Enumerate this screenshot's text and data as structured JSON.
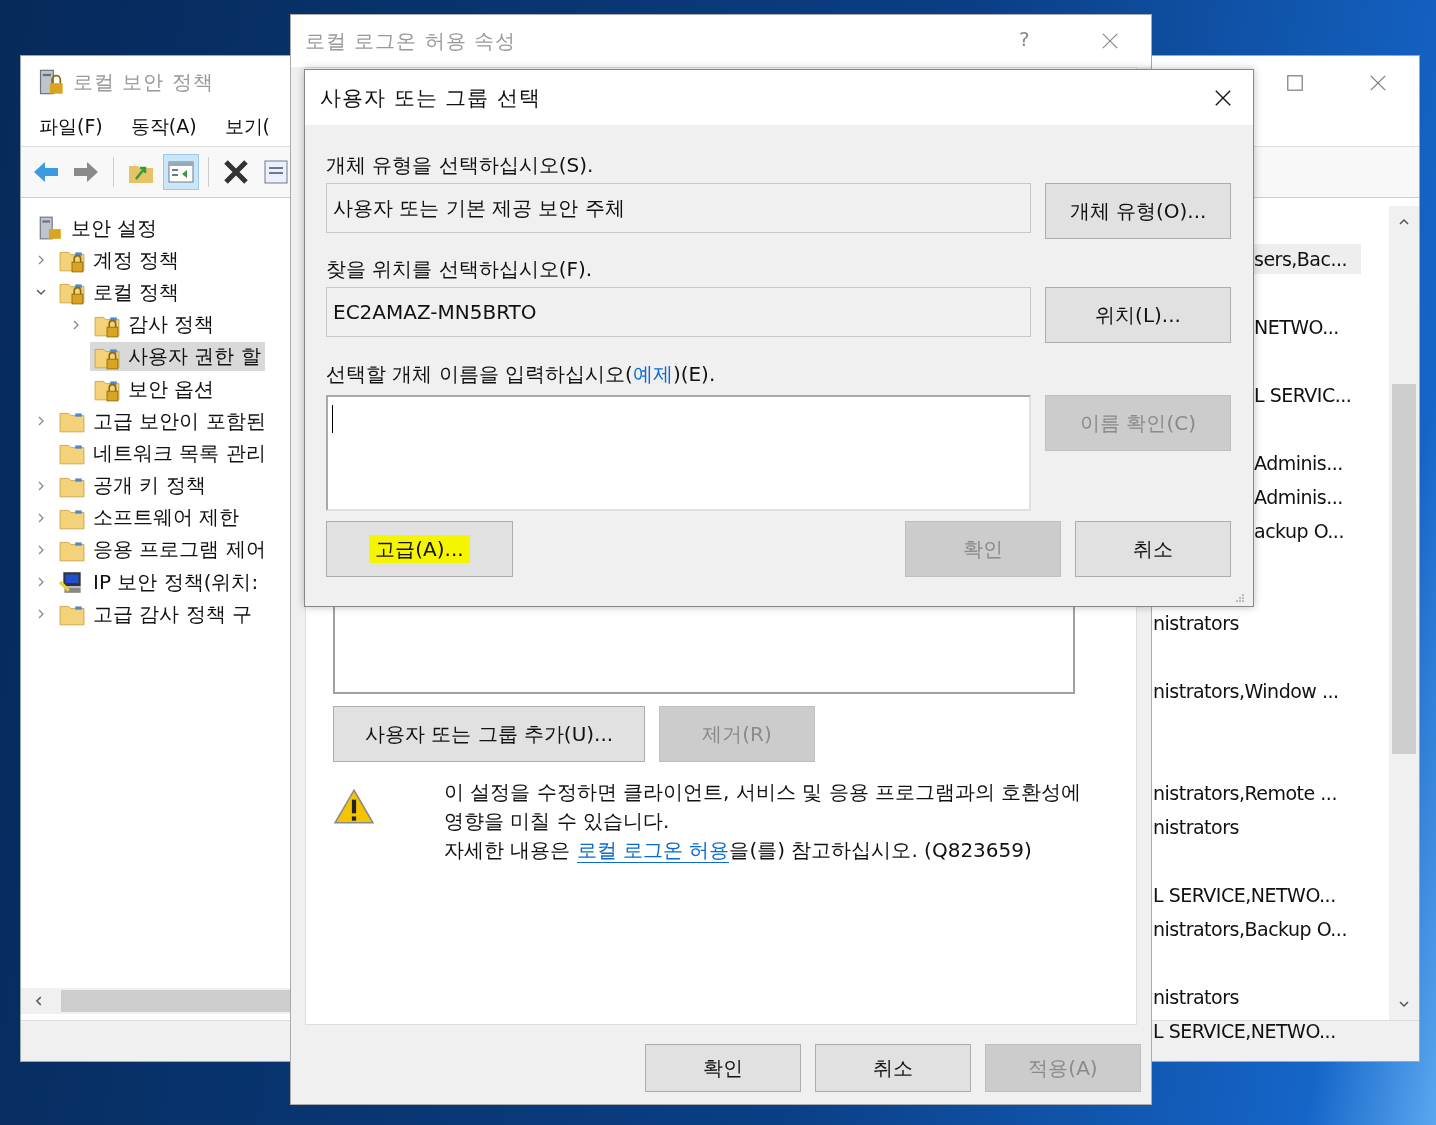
{
  "main_window": {
    "title": "로컬 보안 정책",
    "menu": [
      {
        "label": "파일(F)"
      },
      {
        "label": "동작(A)"
      },
      {
        "label": "보기("
      }
    ],
    "toolbar": [
      {
        "kind": "back",
        "selected": false
      },
      {
        "kind": "forward",
        "selected": false
      },
      {
        "kind": "up",
        "selected": false
      },
      {
        "kind": "pane",
        "selected": true
      },
      {
        "kind": "delete",
        "selected": false
      },
      {
        "kind": "properties",
        "selected": false
      }
    ],
    "tree": [
      {
        "label": "보안 설정",
        "kind": "server",
        "selected": false,
        "children": [
          {
            "label": "계정 정책",
            "kind": "lock-folder",
            "expandable": true,
            "expanded": false,
            "selected": false
          },
          {
            "label": "로컬 정책",
            "kind": "lock-folder",
            "expandable": true,
            "expanded": true,
            "selected": false,
            "children": [
              {
                "label": "감사 정책",
                "kind": "lock-folder",
                "expandable": true,
                "expanded": false,
                "selected": false
              },
              {
                "label": "사용자 권한 할",
                "kind": "lock-folder",
                "expandable": false,
                "selected": true
              },
              {
                "label": "보안 옵션",
                "kind": "lock-folder",
                "expandable": false,
                "selected": false
              }
            ]
          },
          {
            "label": "고급 보안이 포함된",
            "kind": "folder",
            "expandable": true,
            "expanded": false,
            "selected": false
          },
          {
            "label": "네트워크 목록 관리",
            "kind": "folder",
            "expandable": false,
            "selected": false
          },
          {
            "label": "공개 키 정책",
            "kind": "folder",
            "expandable": true,
            "expanded": false,
            "selected": false
          },
          {
            "label": "소프트웨어 제한",
            "kind": "folder",
            "expandable": true,
            "expanded": false,
            "selected": false
          },
          {
            "label": "응용 프로그램 제어",
            "kind": "folder",
            "expandable": true,
            "expanded": false,
            "selected": false
          },
          {
            "label": "IP 보안 정책(위치:",
            "kind": "ip",
            "expandable": true,
            "expanded": false,
            "selected": false
          },
          {
            "label": "고급 감사 정책 구",
            "kind": "folder",
            "expandable": true,
            "expanded": false,
            "selected": false
          }
        ]
      }
    ],
    "right_pane": {
      "rows_beside_picker": [
        {
          "kind": "gap"
        },
        {
          "kind": "text",
          "text": "sers,Bac...",
          "selected": true
        },
        {
          "kind": "gap"
        },
        {
          "kind": "text",
          "text": "NETWO...",
          "selected": false
        },
        {
          "kind": "gap"
        },
        {
          "kind": "text",
          "text": "L SERVIC...",
          "selected": false
        },
        {
          "kind": "gap"
        },
        {
          "kind": "text",
          "text": "Adminis...",
          "selected": false
        },
        {
          "kind": "text",
          "text": "Adminis...",
          "selected": false
        },
        {
          "kind": "text",
          "text": "ackup O...",
          "selected": false
        }
      ],
      "rows_below_picker": [
        {
          "kind": "text",
          "text": "nistrators",
          "selected": false
        },
        {
          "kind": "gap"
        },
        {
          "kind": "text",
          "text": "nistrators,Window ...",
          "selected": false
        },
        {
          "kind": "gap"
        },
        {
          "kind": "gap"
        },
        {
          "kind": "text",
          "text": "nistrators,Remote ...",
          "selected": false
        },
        {
          "kind": "text",
          "text": "nistrators",
          "selected": false
        },
        {
          "kind": "gap"
        },
        {
          "kind": "text",
          "text": "L SERVICE,NETWO...",
          "selected": false
        },
        {
          "kind": "text",
          "text": "nistrators,Backup O...",
          "selected": false
        },
        {
          "kind": "gap"
        },
        {
          "kind": "text",
          "text": "nistrators",
          "selected": false
        },
        {
          "kind": "text",
          "text": "L SERVICE,NETWO...",
          "selected": false
        }
      ]
    }
  },
  "properties_dialog": {
    "title": "로컬 로그온 허용 속성",
    "help": "?",
    "add_button": {
      "label": "사용자 또는 그룹 추가(U)...",
      "disabled": false
    },
    "remove_button": {
      "label": "제거(R)",
      "disabled": true
    },
    "warning": {
      "text": "이 설정을 수정하면 클라이언트, 서비스 및 응용 프로그램과의 호환성에 영향을 미칠 수 있습니다.",
      "more_before": "자세한 내용은 ",
      "more_link": "로컬 로그온 허용",
      "more_after": "을(를) 참고하십시오. (Q823659)"
    },
    "buttons": [
      {
        "label": "확인",
        "disabled": false
      },
      {
        "label": "취소",
        "disabled": false
      },
      {
        "label": "적용(A)",
        "disabled": true
      }
    ]
  },
  "picker": {
    "title": "사용자 또는 그룹 선택",
    "object_type_label": "개체 유형을 선택하십시오(S).",
    "object_type_value": "사용자 또는 기본 제공 보안 주체",
    "object_type_button": {
      "label": "개체 유형(O)...",
      "disabled": false
    },
    "location_label": "찾을 위치를 선택하십시오(F).",
    "location_value": "EC2AMAZ-MN5BRTO",
    "location_button": {
      "label": "위치(L)...",
      "disabled": false
    },
    "names_label": {
      "before": "선택할 개체 이름을 입력하십시오(",
      "link": "예제",
      "after": ")(E)."
    },
    "check_names_button": {
      "label": "이름 확인(C)",
      "disabled": true
    },
    "advanced_button": {
      "label": "고급(A)...",
      "disabled": false,
      "highlighted": true
    },
    "ok_button": {
      "label": "확인",
      "disabled": true
    },
    "cancel_button": {
      "label": "취소",
      "disabled": false
    }
  }
}
